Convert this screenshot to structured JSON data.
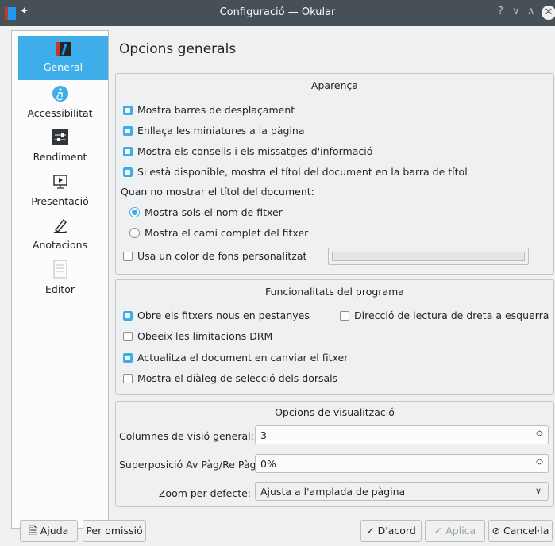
{
  "window": {
    "title": "Configuració — Okular"
  },
  "sidebar": {
    "items": [
      {
        "label": "General",
        "icon": "okular-icon",
        "active": true
      },
      {
        "label": "Accessibilitat",
        "icon": "accessibility-icon"
      },
      {
        "label": "Rendiment",
        "icon": "performance-icon"
      },
      {
        "label": "Presentació",
        "icon": "presentation-icon"
      },
      {
        "label": "Anotacions",
        "icon": "annotations-icon"
      },
      {
        "label": "Editor",
        "icon": "editor-icon"
      }
    ]
  },
  "page": {
    "title": "Opcions generals"
  },
  "appearance": {
    "title": "Aparença",
    "show_scrollbars": "Mostra barres de desplaçament",
    "link_thumbnails": "Enllaça les miniatures a la pàgina",
    "show_hints": "Mostra els consells i els missatges d'informació",
    "show_doc_title": "Si està disponible, mostra el títol del document en la barra de títol",
    "when_not_title": "Quan no mostrar el títol del document:",
    "show_filename": "Mostra sols el nom de fitxer",
    "show_full_path": "Mostra el camí complet del fitxer",
    "custom_bg": "Usa un color de fons personalitzat"
  },
  "program": {
    "title": "Funcionalitats del programa",
    "open_in_tabs": "Obre els fitxers nous en pestanyes",
    "rtl_reading": "Direcció de lectura de dreta a esquerra",
    "obey_drm": "Obeeix les limitacions DRM",
    "reload_on_change": "Actualitza el document en canviar el fitxer",
    "show_backend_dialog": "Mostra el diàleg de selecció dels dorsals"
  },
  "view": {
    "title": "Opcions de visualització",
    "overview_columns_label": "Columnes de visió general:",
    "overview_columns_value": "3",
    "page_overlap_label": "Superposició Av Pàg/Re Pàg:",
    "page_overlap_value": "0%",
    "default_zoom_label": "Zoom per defecte:",
    "default_zoom_value": "Ajusta a l'amplada de pàgina"
  },
  "buttons": {
    "help": "Ajuda",
    "defaults": "Per omissió",
    "ok": "D'acord",
    "apply": "Aplica",
    "cancel": "Cancel·la"
  },
  "colors": {
    "accent": "#3daee9",
    "titlebar": "#475057",
    "window": "#eff0f1"
  }
}
